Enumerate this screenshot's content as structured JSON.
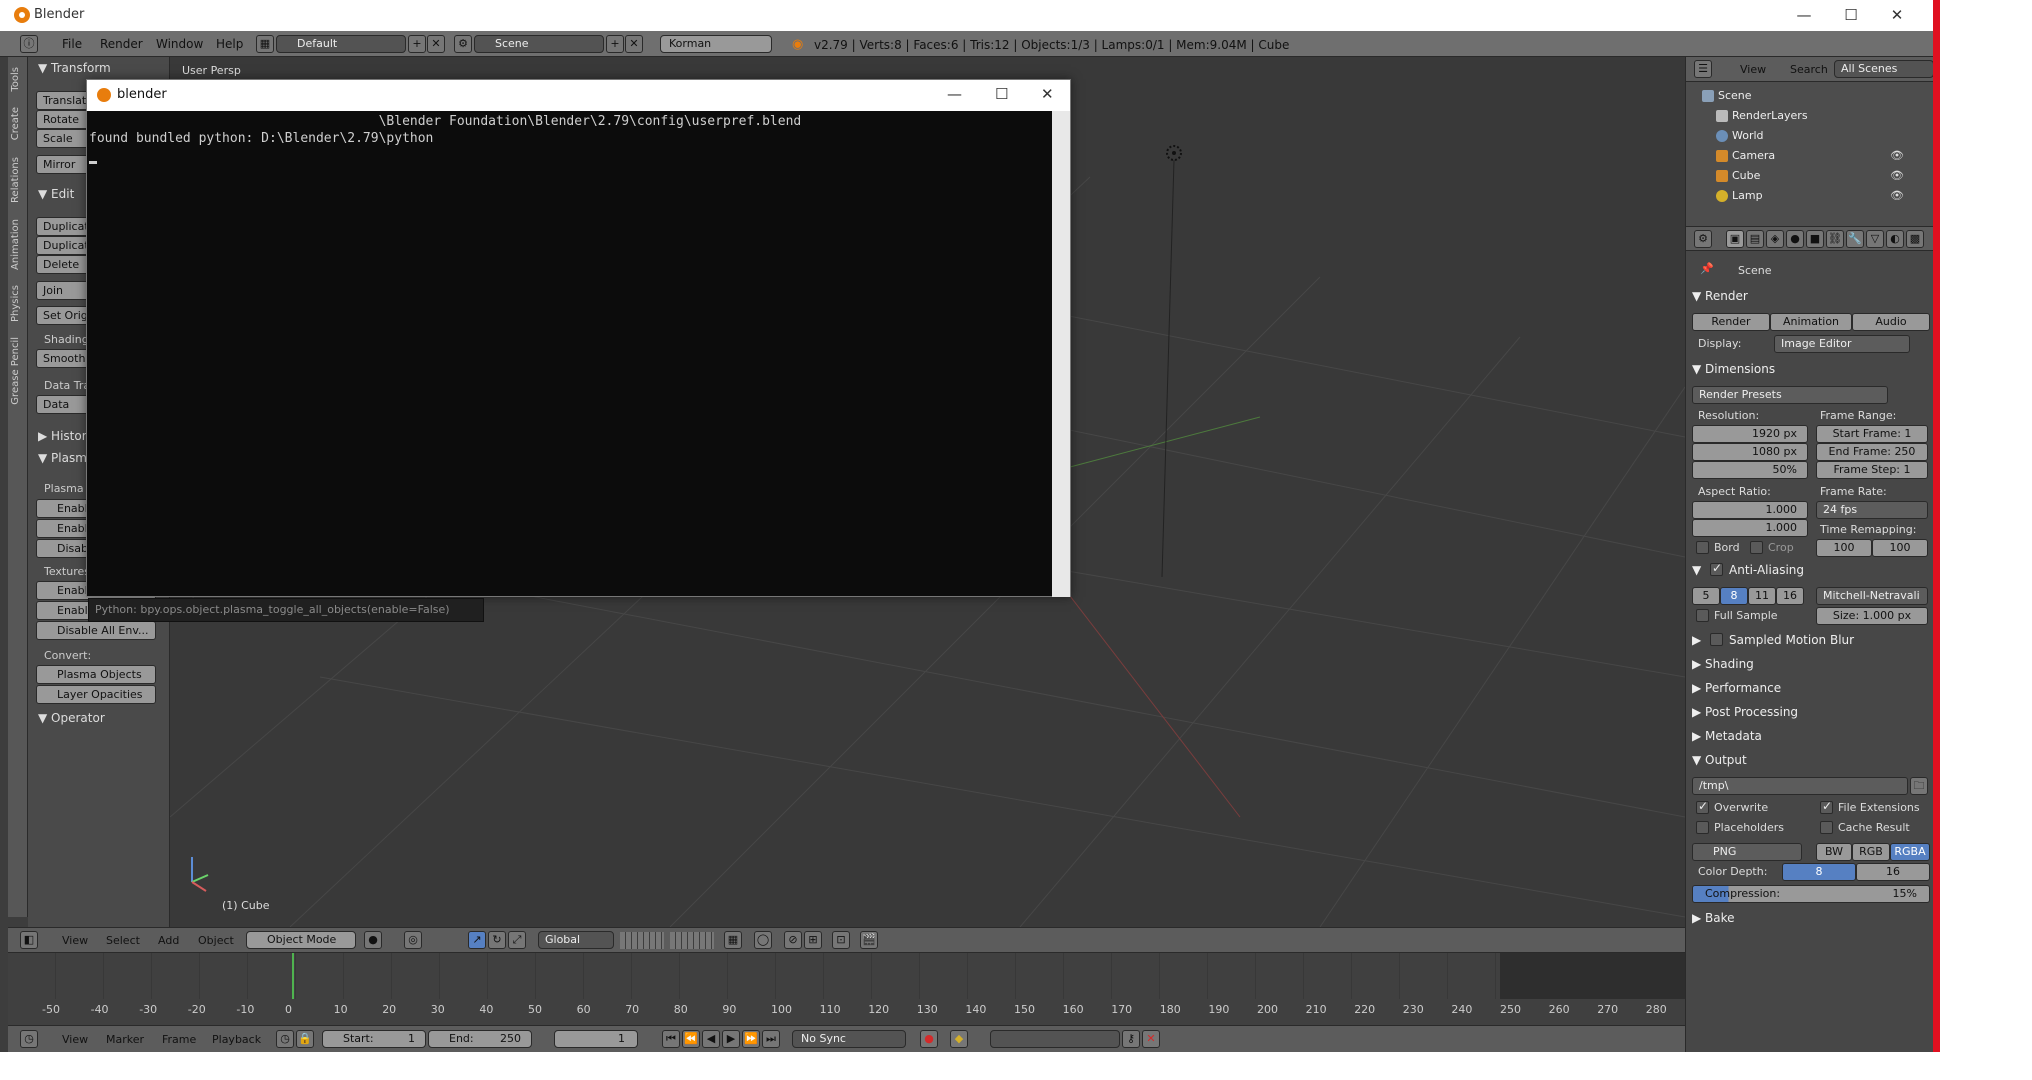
{
  "window": {
    "title": "Blender",
    "minimize": "—",
    "maximize": "☐",
    "close": "✕"
  },
  "topbar": {
    "menus": [
      "File",
      "Render",
      "Window",
      "Help"
    ],
    "layout": "Default",
    "scene": "Scene",
    "engine": "Korman",
    "stats": "v2.79 | Verts:8 | Faces:6 | Tris:12 | Objects:1/3 | Lamps:0/1 | Mem:9.04M | Cube"
  },
  "left_tabs": [
    "Tools",
    "Create",
    "Relations",
    "Animation",
    "Physics",
    "Grease Pencil"
  ],
  "toolshelf": {
    "transform_header": "Transform",
    "translate": "Translate",
    "rotate": "Rotate",
    "scale": "Scale",
    "mirror": "Mirror",
    "edit_header": "Edit",
    "duplicate": "Duplicate",
    "duplicate_linked": "Duplicate Linked",
    "delete": "Delete",
    "join": "Join",
    "set_origin": "Set Origin",
    "shading_label": "Shading:",
    "smooth": "Smooth",
    "data_transfer_label": "Data Transfer:",
    "data": "Data",
    "history_header": "History",
    "plasma_header": "Plasma",
    "plasma_label": "Plasma Objects:",
    "enable_all": "Enable All",
    "enable_selected": "Enable Selection",
    "disable_all": "Disable All",
    "textures_label": "Textures:",
    "enable_all_env": "Enable All Env",
    "enable_sel_env": "Enable Selection Env",
    "disable_all_env": "Disable All Env...",
    "convert_label": "Convert:",
    "plasma_objects": "Plasma Objects",
    "layer_opacities": "Layer Opacities",
    "operator_header": "Operator"
  },
  "viewport": {
    "persp": "User Persp",
    "object_label": "(1) Cube"
  },
  "console": {
    "title": "blender",
    "line1": "                                     \\Blender Foundation\\Blender\\2.79\\config\\userpref.blend",
    "line2": "found bundled python: D:\\Blender\\2.79\\python"
  },
  "tooltip": "Python: bpy.ops.object.plasma_toggle_all_objects(enable=False)",
  "outliner": {
    "view": "View",
    "search": "Search",
    "filter": "All Scenes",
    "items": [
      "Scene",
      "RenderLayers",
      "World",
      "Camera",
      "Cube",
      "Lamp"
    ]
  },
  "properties": {
    "context": "Scene",
    "render_header": "Render",
    "render_btn": "Render",
    "animation_btn": "Animation",
    "audio_btn": "Audio",
    "display_label": "Display:",
    "display_value": "Image Editor",
    "dimensions_header": "Dimensions",
    "render_presets": "Render Presets",
    "resolution_label": "Resolution:",
    "res_x": "1920 px",
    "res_y": "1080 px",
    "res_pct": "50%",
    "frame_range_label": "Frame Range:",
    "start_frame": "Start Frame:",
    "start_value": "1",
    "end_frame": "End Frame:",
    "end_value": "250",
    "frame_step": "Frame Step:",
    "step_value": "1",
    "aspect_label": "Aspect Ratio:",
    "aspect_x": "1.000",
    "aspect_y": "1.000",
    "frame_rate_label": "Frame Rate:",
    "frame_rate": "24 fps",
    "time_remap_label": "Time Remapping:",
    "remap_old": "100",
    "remap_new": "100",
    "border": "Bord",
    "crop": "Crop",
    "aa_header": "Anti-Aliasing",
    "aa_samples": [
      "5",
      "8",
      "11",
      "16"
    ],
    "aa_filter": "Mitchell-Netravali",
    "full_sample": "Full Sample",
    "size_label": "Size:",
    "size_value": "1.000 px",
    "motion_blur": "Sampled Motion Blur",
    "shading": "Shading",
    "performance": "Performance",
    "post_processing": "Post Processing",
    "metadata": "Metadata",
    "output_header": "Output",
    "output_path": "/tmp\\",
    "overwrite": "Overwrite",
    "file_extensions": "File Extensions",
    "placeholders": "Placeholders",
    "cache_result": "Cache Result",
    "format": "PNG",
    "bw": "BW",
    "rgb": "RGB",
    "rgba": "RGBA",
    "color_depth_label": "Color Depth:",
    "depth8": "8",
    "depth16": "16",
    "compression_label": "Compression:",
    "compression_value": "15%",
    "bake": "Bake"
  },
  "view3d_header": {
    "view": "View",
    "select": "Select",
    "add": "Add",
    "object": "Object",
    "mode": "Object Mode",
    "orientation": "Global"
  },
  "timeline": {
    "ticks": [
      "-50",
      "-40",
      "-30",
      "-20",
      "-10",
      "0",
      "10",
      "20",
      "30",
      "40",
      "50",
      "60",
      "70",
      "80",
      "90",
      "100",
      "110",
      "120",
      "130",
      "140",
      "150",
      "160",
      "170",
      "180",
      "190",
      "200",
      "210",
      "220",
      "230",
      "240",
      "250",
      "260",
      "270",
      "280"
    ],
    "view": "View",
    "marker": "Marker",
    "frame": "Frame",
    "playback": "Playback",
    "start_label": "Start:",
    "start_value": "1",
    "end_label": "End:",
    "end_value": "250",
    "current": "1",
    "sync": "No Sync"
  }
}
